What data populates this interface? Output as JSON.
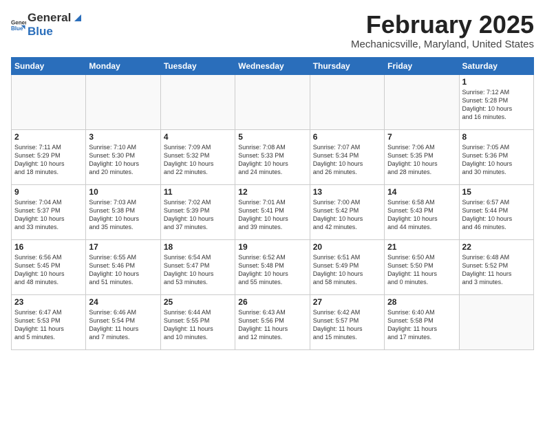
{
  "header": {
    "logo_general": "General",
    "logo_blue": "Blue",
    "month": "February 2025",
    "location": "Mechanicsville, Maryland, United States"
  },
  "weekdays": [
    "Sunday",
    "Monday",
    "Tuesday",
    "Wednesday",
    "Thursday",
    "Friday",
    "Saturday"
  ],
  "weeks": [
    [
      {
        "day": "",
        "info": ""
      },
      {
        "day": "",
        "info": ""
      },
      {
        "day": "",
        "info": ""
      },
      {
        "day": "",
        "info": ""
      },
      {
        "day": "",
        "info": ""
      },
      {
        "day": "",
        "info": ""
      },
      {
        "day": "1",
        "info": "Sunrise: 7:12 AM\nSunset: 5:28 PM\nDaylight: 10 hours\nand 16 minutes."
      }
    ],
    [
      {
        "day": "2",
        "info": "Sunrise: 7:11 AM\nSunset: 5:29 PM\nDaylight: 10 hours\nand 18 minutes."
      },
      {
        "day": "3",
        "info": "Sunrise: 7:10 AM\nSunset: 5:30 PM\nDaylight: 10 hours\nand 20 minutes."
      },
      {
        "day": "4",
        "info": "Sunrise: 7:09 AM\nSunset: 5:32 PM\nDaylight: 10 hours\nand 22 minutes."
      },
      {
        "day": "5",
        "info": "Sunrise: 7:08 AM\nSunset: 5:33 PM\nDaylight: 10 hours\nand 24 minutes."
      },
      {
        "day": "6",
        "info": "Sunrise: 7:07 AM\nSunset: 5:34 PM\nDaylight: 10 hours\nand 26 minutes."
      },
      {
        "day": "7",
        "info": "Sunrise: 7:06 AM\nSunset: 5:35 PM\nDaylight: 10 hours\nand 28 minutes."
      },
      {
        "day": "8",
        "info": "Sunrise: 7:05 AM\nSunset: 5:36 PM\nDaylight: 10 hours\nand 30 minutes."
      }
    ],
    [
      {
        "day": "9",
        "info": "Sunrise: 7:04 AM\nSunset: 5:37 PM\nDaylight: 10 hours\nand 33 minutes."
      },
      {
        "day": "10",
        "info": "Sunrise: 7:03 AM\nSunset: 5:38 PM\nDaylight: 10 hours\nand 35 minutes."
      },
      {
        "day": "11",
        "info": "Sunrise: 7:02 AM\nSunset: 5:39 PM\nDaylight: 10 hours\nand 37 minutes."
      },
      {
        "day": "12",
        "info": "Sunrise: 7:01 AM\nSunset: 5:41 PM\nDaylight: 10 hours\nand 39 minutes."
      },
      {
        "day": "13",
        "info": "Sunrise: 7:00 AM\nSunset: 5:42 PM\nDaylight: 10 hours\nand 42 minutes."
      },
      {
        "day": "14",
        "info": "Sunrise: 6:58 AM\nSunset: 5:43 PM\nDaylight: 10 hours\nand 44 minutes."
      },
      {
        "day": "15",
        "info": "Sunrise: 6:57 AM\nSunset: 5:44 PM\nDaylight: 10 hours\nand 46 minutes."
      }
    ],
    [
      {
        "day": "16",
        "info": "Sunrise: 6:56 AM\nSunset: 5:45 PM\nDaylight: 10 hours\nand 48 minutes."
      },
      {
        "day": "17",
        "info": "Sunrise: 6:55 AM\nSunset: 5:46 PM\nDaylight: 10 hours\nand 51 minutes."
      },
      {
        "day": "18",
        "info": "Sunrise: 6:54 AM\nSunset: 5:47 PM\nDaylight: 10 hours\nand 53 minutes."
      },
      {
        "day": "19",
        "info": "Sunrise: 6:52 AM\nSunset: 5:48 PM\nDaylight: 10 hours\nand 55 minutes."
      },
      {
        "day": "20",
        "info": "Sunrise: 6:51 AM\nSunset: 5:49 PM\nDaylight: 10 hours\nand 58 minutes."
      },
      {
        "day": "21",
        "info": "Sunrise: 6:50 AM\nSunset: 5:50 PM\nDaylight: 11 hours\nand 0 minutes."
      },
      {
        "day": "22",
        "info": "Sunrise: 6:48 AM\nSunset: 5:52 PM\nDaylight: 11 hours\nand 3 minutes."
      }
    ],
    [
      {
        "day": "23",
        "info": "Sunrise: 6:47 AM\nSunset: 5:53 PM\nDaylight: 11 hours\nand 5 minutes."
      },
      {
        "day": "24",
        "info": "Sunrise: 6:46 AM\nSunset: 5:54 PM\nDaylight: 11 hours\nand 7 minutes."
      },
      {
        "day": "25",
        "info": "Sunrise: 6:44 AM\nSunset: 5:55 PM\nDaylight: 11 hours\nand 10 minutes."
      },
      {
        "day": "26",
        "info": "Sunrise: 6:43 AM\nSunset: 5:56 PM\nDaylight: 11 hours\nand 12 minutes."
      },
      {
        "day": "27",
        "info": "Sunrise: 6:42 AM\nSunset: 5:57 PM\nDaylight: 11 hours\nand 15 minutes."
      },
      {
        "day": "28",
        "info": "Sunrise: 6:40 AM\nSunset: 5:58 PM\nDaylight: 11 hours\nand 17 minutes."
      },
      {
        "day": "",
        "info": ""
      }
    ]
  ]
}
